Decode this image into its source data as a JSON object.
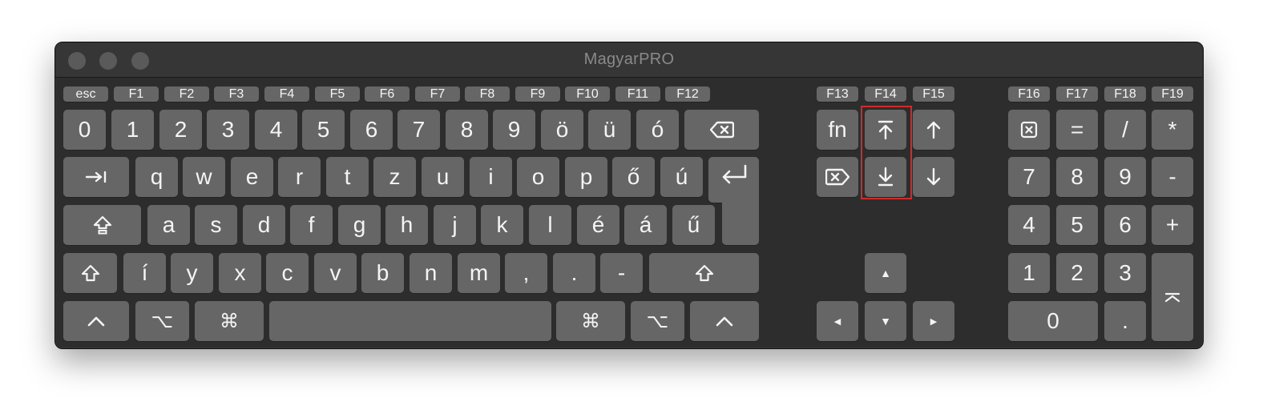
{
  "window": {
    "title": "MagyarPRO",
    "controls": [
      "close",
      "minimize",
      "zoom"
    ]
  },
  "function_row": {
    "esc": "esc",
    "main": [
      "F1",
      "F2",
      "F3",
      "F4",
      "F5",
      "F6",
      "F7",
      "F8",
      "F9",
      "F10",
      "F11",
      "F12"
    ],
    "nav": [
      "F13",
      "F14",
      "F15"
    ],
    "numpad": [
      "F16",
      "F17",
      "F18",
      "F19"
    ]
  },
  "rows": {
    "number_row": [
      "0",
      "1",
      "2",
      "3",
      "4",
      "5",
      "6",
      "7",
      "8",
      "9",
      "ö",
      "ü",
      "ó"
    ],
    "top_row": [
      "q",
      "w",
      "e",
      "r",
      "t",
      "z",
      "u",
      "i",
      "o",
      "p",
      "ő",
      "ú"
    ],
    "home_row": [
      "a",
      "s",
      "d",
      "f",
      "g",
      "h",
      "j",
      "k",
      "l",
      "é",
      "á",
      "ű"
    ],
    "bottom_row": [
      "í",
      "y",
      "x",
      "c",
      "v",
      "b",
      "n",
      "m",
      ",",
      ".",
      "-"
    ]
  },
  "modifiers": {
    "control": "^",
    "option": "⌥",
    "command": "⌘"
  },
  "nav_cluster": {
    "fn": "fn",
    "up": "▲",
    "left": "◀",
    "down": "▼",
    "right": "▶"
  },
  "numpad": {
    "row1": [
      "=",
      "/",
      "*"
    ],
    "row2": [
      "7",
      "8",
      "9",
      "-"
    ],
    "row3": [
      "4",
      "5",
      "6",
      "+"
    ],
    "row4": [
      "1",
      "2",
      "3"
    ],
    "row5": [
      "0",
      "."
    ]
  },
  "highlighted_keys": [
    "page-up",
    "page-down"
  ],
  "colors": {
    "window_bg": "#2d2d2d",
    "key_bg": "#666666",
    "key_text": "#f4f4f4",
    "highlight": "#d12a2a"
  }
}
